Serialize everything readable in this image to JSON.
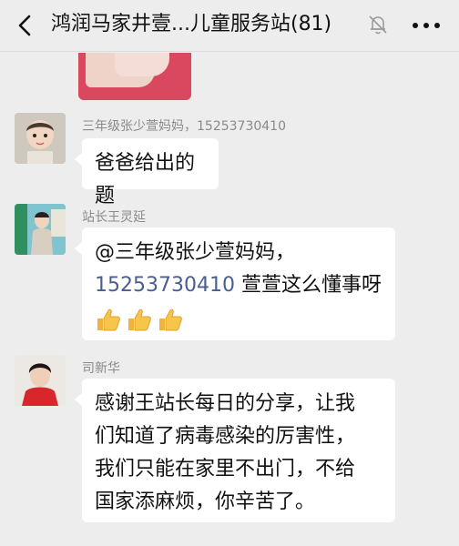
{
  "header": {
    "title": "鸿润马家井壹...儿童服务站(81)"
  },
  "messages": [
    {
      "sender": "三年级张少萱妈妈，15253730410",
      "text": "爸爸给出的题"
    },
    {
      "sender": "站长王灵延",
      "mention": "@三年级张少萱妈妈，",
      "phone": "15253730410",
      "text": " 萱萱这么懂事呀",
      "emojis": [
        "thumbs-up",
        "thumbs-up",
        "thumbs-up"
      ]
    },
    {
      "sender": "司新华",
      "lines": [
        "感谢王站长每日的分享，让我",
        "们知道了病毒感染的厉害性，",
        "我们只能在家里不出门，不给",
        "国家添麻烦，你辛苦了。"
      ]
    }
  ],
  "colors": {
    "background": "#ededed",
    "bubble": "#ffffff",
    "link": "#4a5f8f",
    "sender": "#8a8a8a"
  }
}
